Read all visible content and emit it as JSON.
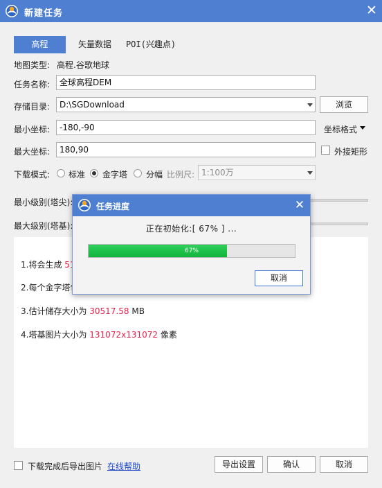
{
  "window": {
    "title": "新建任务",
    "close": "✕"
  },
  "tabs": [
    {
      "label": "高程",
      "active": true
    },
    {
      "label": "矢量数据",
      "active": false
    },
    {
      "label": "POI(兴趣点)",
      "active": false
    }
  ],
  "form": {
    "map_type_label": "地图类型:",
    "map_type_value": "高程.谷歌地球",
    "task_name_label": "任务名称:",
    "task_name_value": "全球高程DEM",
    "storage_label": "存储目录:",
    "storage_value": "D:\\SGDownload",
    "browse_button": "浏览",
    "min_coord_label": "最小坐标:",
    "min_coord_value": "-180,-90",
    "coord_format_button": "坐标格式",
    "max_coord_label": "最大坐标:",
    "max_coord_value": "180,90",
    "outer_rect_label": "外接矩形",
    "download_mode_label": "下载模式:",
    "mode_standard": "标准",
    "mode_pyramid": "金字塔",
    "mode_tiled": "分幅",
    "scale_label": "比例尺:",
    "scale_value": "1:100万",
    "min_level_label": "最小级别(塔尖):",
    "max_level_label": "最大级别(塔基):"
  },
  "info": {
    "line1_prefix": "1.将会生成",
    "line1_value": "51",
    "line2": "2.每个金字塔包",
    "line3_prefix": "3.估计储存大小为",
    "line3_value": "30517.58",
    "line3_unit": "MB",
    "line4_prefix": "4.塔基图片大小为",
    "line4_value": "131072x131072",
    "line4_unit": "像素"
  },
  "footer": {
    "export_after_label": "下载完成后导出图片",
    "help_link": "在线帮助",
    "export_settings_button": "导出设置",
    "ok_button": "确认",
    "cancel_button": "取消"
  },
  "progress_dialog": {
    "title": "任务进度",
    "close": "✕",
    "message": "正在初始化:[ 67% ] ...",
    "progress_percent": 67,
    "progress_text": "67%",
    "cancel_button": "取消"
  },
  "colors": {
    "accent": "#4f7fd0",
    "highlight": "#e5204a",
    "progress": "#1cbf47"
  },
  "icons": {
    "app": "globe-logo-icon"
  }
}
